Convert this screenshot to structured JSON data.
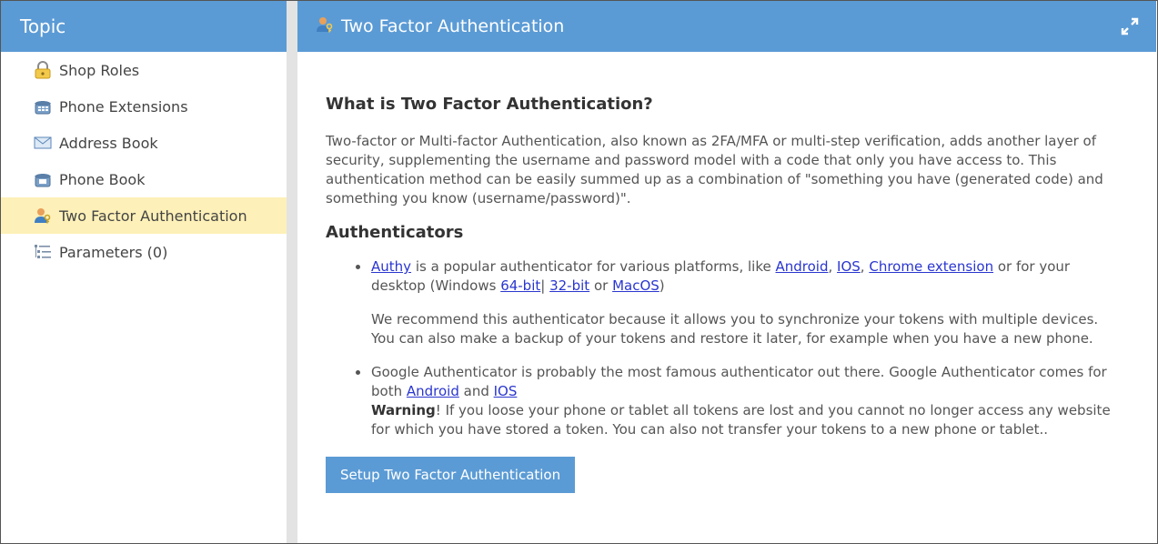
{
  "sidebar": {
    "title": "Topic",
    "items": [
      {
        "label": "Shop Roles",
        "icon": "lock-icon"
      },
      {
        "label": "Phone Extensions",
        "icon": "phone-extension-icon"
      },
      {
        "label": "Address Book",
        "icon": "envelope-icon"
      },
      {
        "label": "Phone Book",
        "icon": "phone-icon"
      },
      {
        "label": "Two Factor Authentication",
        "icon": "user-key-icon",
        "active": true
      },
      {
        "label": "Parameters (0)",
        "icon": "list-icon"
      }
    ]
  },
  "header": {
    "title": "Two Factor Authentication",
    "icon": "user-key-icon",
    "expand_icon": "expand-icon"
  },
  "content": {
    "heading": "What is Two Factor Authentication?",
    "intro": "Two-factor or Multi-factor Authentication, also known as 2FA/MFA or multi-step verification, adds another layer of security, supplementing the username and password model with a code that only you have access to. This authentication method can be easily summed up as a combination of \"something you have (generated code) and something you know (username/password)\".",
    "authenticators_heading": "Authenticators",
    "authy": {
      "name_link": "Authy",
      "text1": " is a popular authenticator for various platforms, like ",
      "android_link": "Android",
      "sep1": ", ",
      "ios_link": "IOS",
      "sep2": ", ",
      "chrome_link": "Chrome extension",
      "text2": " or for your desktop (Windows ",
      "win64_link": "64-bit",
      "sep3": "| ",
      "win32_link": "32-bit",
      "text3": " or ",
      "macos_link": "MacOS",
      "text4": ")",
      "recommendation": "We recommend this authenticator because it allows you to synchronize your tokens with multiple devices. You can also make a backup of your tokens and restore it later, for example when you have a new phone."
    },
    "google": {
      "text1": "Google Authenticator is probably the most famous authenticator out there. Google Authenticator comes for both ",
      "android_link": "Android",
      "text2": " and ",
      "ios_link": "IOS",
      "warning_label": "Warning",
      "warning_text": "! If you loose your phone or tablet all tokens are lost and you cannot no longer access any website for which you have stored a token. You can also not transfer your tokens to a new phone or tablet.."
    },
    "setup_button": "Setup Two Factor Authentication"
  },
  "colors": {
    "header_blue": "#5b9bd5",
    "active_item": "#fdf0b8",
    "link": "#2a36cf"
  }
}
